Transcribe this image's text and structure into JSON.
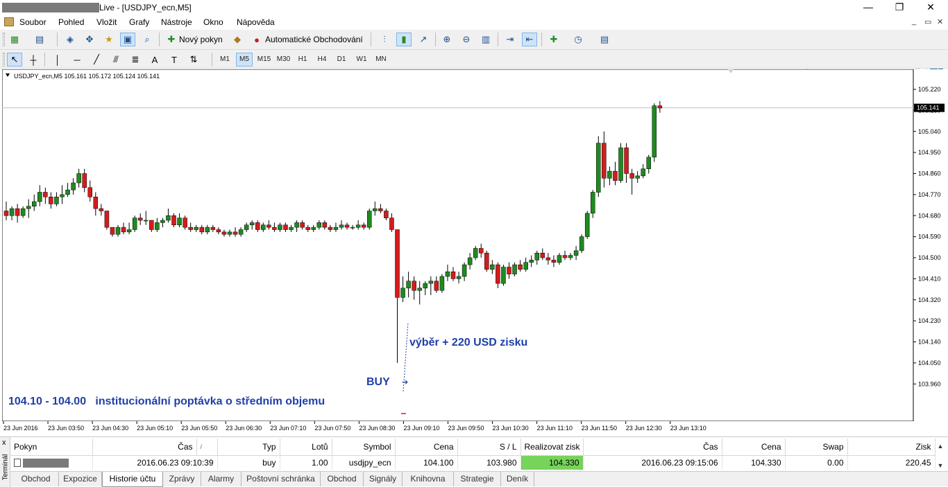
{
  "window": {
    "title": "Live - [USDJPY_ecn,M5]",
    "controls": [
      "—",
      "❐",
      "✕"
    ]
  },
  "menu": [
    "Soubor",
    "Pohled",
    "Vložit",
    "Grafy",
    "Nástroje",
    "Okno",
    "Nápověda"
  ],
  "mdi_controls": [
    "_",
    "▭",
    "✕"
  ],
  "toolbar": {
    "new_order": "Nový pokyn",
    "auto_trading": "Automatické Obchodování",
    "timeframes": [
      "M1",
      "M5",
      "M15",
      "M30",
      "H1",
      "H4",
      "D1",
      "W1",
      "MN"
    ],
    "active_timeframe": "M5"
  },
  "chart": {
    "header": "USDJPY_ecn,M5  105.161 105.172 105.124 105.141",
    "current_price": "105.141",
    "price_labels": [
      "105.220",
      "105.130",
      "105.040",
      "104.950",
      "104.860",
      "104.770",
      "104.680",
      "104.590",
      "104.500",
      "104.410",
      "104.320",
      "104.230",
      "104.140",
      "104.050",
      "103.960"
    ],
    "time_labels": [
      "23 Jun 2016",
      "23 Jun 03:50",
      "23 Jun 04:30",
      "23 Jun 05:10",
      "23 Jun 05:50",
      "23 Jun 06:30",
      "23 Jun 07:10",
      "23 Jun 07:50",
      "23 Jun 08:30",
      "23 Jun 09:10",
      "23 Jun 09:50",
      "23 Jun 10:30",
      "23 Jun 11:10",
      "23 Jun 11:50",
      "23 Jun 12:30",
      "23 Jun 13:10"
    ],
    "annotations": {
      "profit": "výběr + 220 USD zisku",
      "buy": "BUY",
      "zone": "104.10 - 104.00   institucionální poptávka o středním objemu"
    },
    "colors": {
      "bull": "#1f8a1f",
      "bear": "#d41c1c",
      "wick": "#000000",
      "annotation": "#1f3fa8",
      "price_line": "#c0c0c0"
    }
  },
  "chart_data": {
    "type": "candlestick",
    "title": "USDJPY_ecn,M5",
    "ylim": [
      103.96,
      105.22
    ],
    "candles": [
      [
        104.7,
        104.74,
        104.66,
        104.68
      ],
      [
        104.68,
        104.72,
        104.66,
        104.71
      ],
      [
        104.71,
        104.73,
        104.65,
        104.68
      ],
      [
        104.68,
        104.72,
        104.67,
        104.71
      ],
      [
        104.71,
        104.75,
        104.67,
        104.72
      ],
      [
        104.72,
        104.77,
        104.7,
        104.74
      ],
      [
        104.74,
        104.81,
        104.72,
        104.78
      ],
      [
        104.78,
        104.8,
        104.73,
        104.76
      ],
      [
        104.76,
        104.78,
        104.71,
        104.73
      ],
      [
        104.73,
        104.78,
        104.72,
        104.76
      ],
      [
        104.76,
        104.81,
        104.73,
        104.77
      ],
      [
        104.77,
        104.82,
        104.76,
        104.79
      ],
      [
        104.79,
        104.84,
        104.77,
        104.82
      ],
      [
        104.82,
        104.88,
        104.8,
        104.86
      ],
      [
        104.86,
        104.88,
        104.78,
        104.8
      ],
      [
        104.8,
        104.83,
        104.74,
        104.76
      ],
      [
        104.76,
        104.78,
        104.68,
        104.71
      ],
      [
        104.71,
        104.73,
        104.68,
        104.7
      ],
      [
        104.7,
        104.7,
        104.62,
        104.63
      ],
      [
        104.63,
        104.63,
        104.59,
        104.6
      ],
      [
        104.6,
        104.64,
        104.59,
        104.63
      ],
      [
        104.63,
        104.65,
        104.6,
        104.61
      ],
      [
        104.61,
        104.65,
        104.6,
        104.62
      ],
      [
        104.62,
        104.68,
        104.61,
        104.67
      ],
      [
        104.67,
        104.69,
        104.64,
        104.66
      ],
      [
        104.66,
        104.7,
        104.64,
        104.66
      ],
      [
        104.66,
        104.66,
        104.61,
        104.62
      ],
      [
        104.62,
        104.67,
        104.61,
        104.65
      ],
      [
        104.65,
        104.67,
        104.63,
        104.66
      ],
      [
        104.66,
        104.71,
        104.65,
        104.68
      ],
      [
        104.68,
        104.69,
        104.63,
        104.64
      ],
      [
        104.64,
        104.69,
        104.63,
        104.67
      ],
      [
        104.67,
        104.68,
        104.62,
        104.63
      ],
      [
        104.63,
        104.65,
        104.61,
        104.62
      ],
      [
        104.62,
        104.64,
        104.61,
        104.63
      ],
      [
        104.63,
        104.64,
        104.6,
        104.61
      ],
      [
        104.61,
        104.64,
        104.6,
        104.63
      ],
      [
        104.63,
        104.64,
        104.61,
        104.62
      ],
      [
        104.62,
        104.63,
        104.6,
        104.61
      ],
      [
        104.61,
        104.62,
        104.59,
        104.6
      ],
      [
        104.6,
        104.62,
        104.59,
        104.61
      ],
      [
        104.61,
        104.63,
        104.59,
        104.6
      ],
      [
        104.6,
        104.63,
        104.59,
        104.62
      ],
      [
        104.62,
        104.65,
        104.61,
        104.64
      ],
      [
        104.64,
        104.66,
        104.62,
        104.65
      ],
      [
        104.65,
        104.66,
        104.61,
        104.62
      ],
      [
        104.62,
        104.65,
        104.61,
        104.64
      ],
      [
        104.64,
        104.66,
        104.62,
        104.63
      ],
      [
        104.63,
        104.65,
        104.61,
        104.62
      ],
      [
        104.62,
        104.65,
        104.61,
        104.64
      ],
      [
        104.64,
        104.65,
        104.61,
        104.62
      ],
      [
        104.62,
        104.64,
        104.61,
        104.63
      ],
      [
        104.63,
        104.66,
        104.61,
        104.65
      ],
      [
        104.65,
        104.66,
        104.62,
        104.63
      ],
      [
        104.63,
        104.64,
        104.61,
        104.62
      ],
      [
        104.62,
        104.64,
        104.61,
        104.63
      ],
      [
        104.63,
        104.66,
        104.62,
        104.65
      ],
      [
        104.65,
        104.66,
        104.62,
        104.63
      ],
      [
        104.63,
        104.64,
        104.61,
        104.62
      ],
      [
        104.62,
        104.65,
        104.61,
        104.63
      ],
      [
        104.63,
        104.66,
        104.62,
        104.64
      ],
      [
        104.64,
        104.65,
        104.62,
        104.63
      ],
      [
        104.63,
        104.64,
        104.62,
        104.63
      ],
      [
        104.63,
        104.66,
        104.62,
        104.64
      ],
      [
        104.64,
        104.65,
        104.62,
        104.63
      ],
      [
        104.63,
        104.71,
        104.62,
        104.7
      ],
      [
        104.7,
        104.74,
        104.68,
        104.71
      ],
      [
        104.71,
        104.73,
        104.69,
        104.7
      ],
      [
        104.7,
        104.71,
        104.66,
        104.67
      ],
      [
        104.67,
        104.69,
        104.61,
        104.62
      ],
      [
        104.62,
        104.62,
        104.05,
        104.33
      ],
      [
        104.33,
        104.42,
        104.31,
        104.37
      ],
      [
        104.37,
        104.44,
        104.33,
        104.4
      ],
      [
        104.4,
        104.42,
        104.32,
        104.36
      ],
      [
        104.36,
        104.4,
        104.3,
        104.37
      ],
      [
        104.37,
        104.4,
        104.34,
        104.39
      ],
      [
        104.39,
        104.42,
        104.34,
        104.4
      ],
      [
        104.4,
        104.42,
        104.35,
        104.36
      ],
      [
        104.36,
        104.43,
        104.35,
        104.42
      ],
      [
        104.42,
        104.47,
        104.4,
        104.44
      ],
      [
        104.44,
        104.46,
        104.4,
        104.41
      ],
      [
        104.41,
        104.44,
        104.39,
        104.42
      ],
      [
        104.42,
        104.48,
        104.4,
        104.47
      ],
      [
        104.47,
        104.52,
        104.45,
        104.5
      ],
      [
        104.5,
        104.55,
        104.49,
        104.54
      ],
      [
        104.54,
        104.56,
        104.5,
        104.52
      ],
      [
        104.52,
        104.53,
        104.44,
        104.45
      ],
      [
        104.45,
        104.49,
        104.43,
        104.47
      ],
      [
        104.47,
        104.48,
        104.37,
        104.39
      ],
      [
        104.39,
        104.47,
        104.38,
        104.46
      ],
      [
        104.46,
        104.48,
        104.41,
        104.43
      ],
      [
        104.43,
        104.48,
        104.42,
        104.47
      ],
      [
        104.47,
        104.49,
        104.44,
        104.45
      ],
      [
        104.45,
        104.5,
        104.44,
        104.48
      ],
      [
        104.48,
        104.51,
        104.46,
        104.49
      ],
      [
        104.49,
        104.53,
        104.47,
        104.52
      ],
      [
        104.52,
        104.54,
        104.49,
        104.5
      ],
      [
        104.5,
        104.52,
        104.47,
        104.49
      ],
      [
        104.49,
        104.51,
        104.46,
        104.48
      ],
      [
        104.48,
        104.52,
        104.47,
        104.51
      ],
      [
        104.51,
        104.53,
        104.49,
        104.5
      ],
      [
        104.5,
        104.52,
        104.49,
        104.51
      ],
      [
        104.51,
        104.55,
        104.49,
        104.53
      ],
      [
        104.53,
        104.6,
        104.52,
        104.59
      ],
      [
        104.59,
        104.7,
        104.58,
        104.69
      ],
      [
        104.69,
        104.79,
        104.67,
        104.78
      ],
      [
        104.78,
        105.02,
        104.76,
        104.99
      ],
      [
        104.99,
        105.04,
        104.8,
        104.84
      ],
      [
        104.84,
        104.89,
        104.81,
        104.87
      ],
      [
        104.87,
        104.91,
        104.81,
        104.83
      ],
      [
        104.83,
        104.99,
        104.82,
        104.97
      ],
      [
        104.97,
        104.99,
        104.82,
        104.86
      ],
      [
        104.86,
        104.88,
        104.77,
        104.84
      ],
      [
        104.84,
        104.87,
        104.82,
        104.85
      ],
      [
        104.85,
        104.9,
        104.84,
        104.88
      ],
      [
        104.88,
        104.94,
        104.86,
        104.93
      ],
      [
        104.93,
        105.16,
        104.91,
        105.15
      ],
      [
        105.15,
        105.17,
        105.12,
        105.14
      ]
    ]
  },
  "terminal": {
    "side_label": "Terminál",
    "close": "x",
    "headers": [
      "Pokyn",
      "Čas",
      "/",
      "Typ",
      "Lotů",
      "Symbol",
      "Cena",
      "S / L",
      "Realizovat zisk",
      "Čas",
      "Cena",
      "Swap",
      "Zisk"
    ],
    "row": {
      "time": "2016.06.23 09:10:39",
      "type": "buy",
      "lots": "1.00",
      "symbol": "usdjpy_ecn",
      "price": "104.100",
      "sl": "103.980",
      "tp": "104.330",
      "close_time": "2016.06.23 09:15:06",
      "close_price": "104.330",
      "swap": "0.00",
      "profit": "220.45"
    },
    "tabs": [
      "Obchod",
      "Expozice",
      "Historie účtu",
      "Zprávy",
      "Alarmy",
      "Poštovní schránka",
      "Obchod",
      "Signály",
      "Knihovna",
      "Strategie",
      "Deník"
    ],
    "active_tab": "Historie účtu"
  }
}
